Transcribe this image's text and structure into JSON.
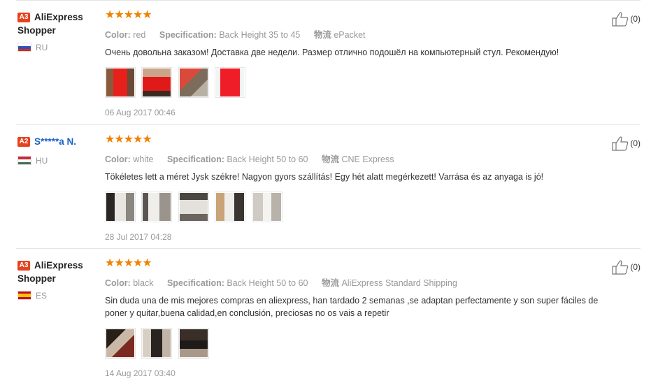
{
  "labels": {
    "color": "Color:",
    "spec": "Specification:",
    "shipping": "物流"
  },
  "reviews": [
    {
      "rank": "A3",
      "name": "AliExpress Shopper",
      "country": "RU",
      "stars": 5,
      "color": "red",
      "spec": "Back Height 35 to 45",
      "shipping": "ePacket",
      "text": "Очень довольна заказом! Доставка две недели. Размер отлично подошёл на компьютерный стул. Рекомендую!",
      "photos": 4,
      "date": "06 Aug 2017 00:46",
      "likes": "(0)"
    },
    {
      "rank": "A2",
      "name": "S*****a N.",
      "country": "HU",
      "stars": 5,
      "color": "white",
      "spec": "Back Height 50 to 60",
      "shipping": "CNE Express",
      "text": "Tökéletes lett a méret Jysk székre! Nagyon gyors szállítás! Egy hét alatt megérkezett! Varrása és az anyaga is jó!",
      "photos": 5,
      "date": "28 Jul 2017 04:28",
      "likes": "(0)"
    },
    {
      "rank": "A3",
      "name": "AliExpress Shopper",
      "country": "ES",
      "stars": 5,
      "color": "black",
      "spec": "Back Height 50 to 60",
      "shipping": "AliExpress Standard Shipping",
      "text": "Sin duda una de mis mejores compras en aliexpress, han tardado 2 semanas ,se adaptan perfectamente y son super fáciles de poner y quitar,buena calidad,en conclusión, preciosas no os vais a repetir",
      "photos": 3,
      "date": "14 Aug 2017 03:40",
      "likes": "(0)"
    }
  ]
}
